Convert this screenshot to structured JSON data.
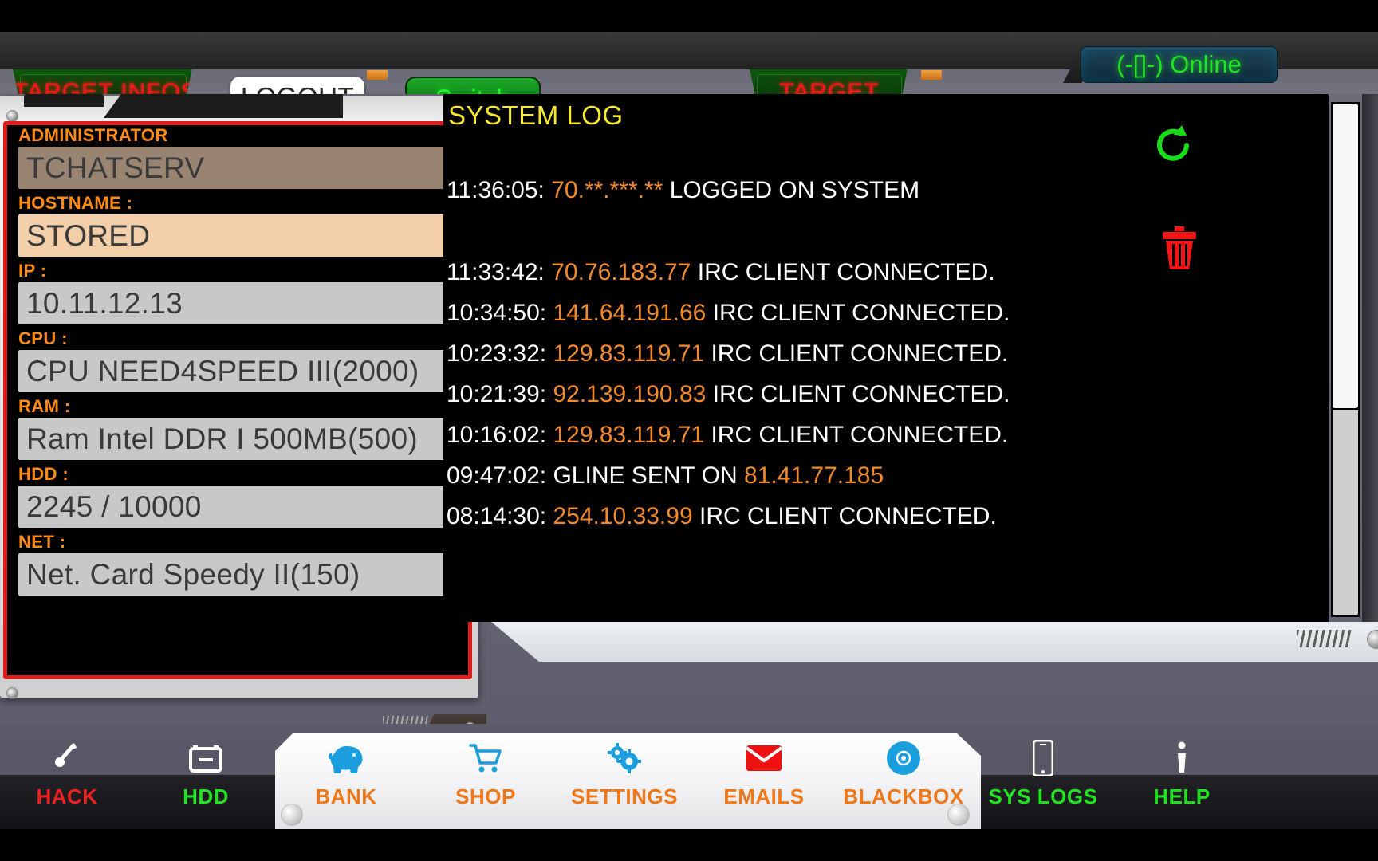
{
  "topbar": {
    "target_infos_tab": "TARGET INFOS",
    "logout_button": "LOGOUT",
    "switch_button": "Switch",
    "target_tab": "TARGET",
    "online_status": "(-[]-) Online"
  },
  "target_info": {
    "fields": [
      {
        "label": "ADMINISTRATOR",
        "value": "TCHATSERV",
        "style": "v-admin"
      },
      {
        "label": "HOSTNAME :",
        "value": "STORED",
        "style": "v-host"
      },
      {
        "label": "IP :",
        "value": "10.11.12.13",
        "style": "v-plain"
      },
      {
        "label": "CPU :",
        "value": "CPU NEED4SPEED III(2000)",
        "style": "v-plain"
      },
      {
        "label": "RAM :",
        "value": "Ram Intel DDR I 500MB(500)",
        "style": "v-plain"
      },
      {
        "label": "HDD :",
        "value": "2245 / 10000",
        "style": "v-plain"
      },
      {
        "label": "NET :",
        "value": "Net. Card Speedy II(150)",
        "style": "v-plain"
      }
    ]
  },
  "system_log": {
    "title": "SYSTEM LOG",
    "refresh_icon": "refresh-icon",
    "delete_icon": "trash-icon",
    "entries": [
      {
        "time": "11:36:05:",
        "ip": "70.**.***.**",
        "message": "LOGGED ON SYSTEM",
        "ip_first": true,
        "spaced": true
      },
      {
        "time": "11:33:42:",
        "ip": "70.76.183.77",
        "message": "IRC CLIENT CONNECTED.",
        "ip_first": true,
        "spaced": false
      },
      {
        "time": "10:34:50:",
        "ip": "141.64.191.66",
        "message": "IRC CLIENT CONNECTED.",
        "ip_first": true,
        "spaced": false
      },
      {
        "time": "10:23:32:",
        "ip": "129.83.119.71",
        "message": "IRC CLIENT CONNECTED.",
        "ip_first": true,
        "spaced": false
      },
      {
        "time": "10:21:39:",
        "ip": "92.139.190.83",
        "message": "IRC CLIENT CONNECTED.",
        "ip_first": true,
        "spaced": false
      },
      {
        "time": "10:16:02:",
        "ip": "129.83.119.71",
        "message": "IRC CLIENT CONNECTED.",
        "ip_first": true,
        "spaced": false
      },
      {
        "time": "09:47:02:",
        "ip": "81.41.77.185",
        "message": "GLINE SENT ON",
        "ip_first": false,
        "spaced": false
      },
      {
        "time": "08:14:30:",
        "ip": "254.10.33.99",
        "message": "IRC CLIENT CONNECTED.",
        "ip_first": true,
        "spaced": false
      }
    ]
  },
  "bottom_nav": [
    {
      "label": "HACK",
      "icon": "wrench-icon",
      "color": "lbl-red"
    },
    {
      "label": "HDD",
      "icon": "drive-icon",
      "color": "lbl-green"
    },
    {
      "label": "BANK",
      "icon": "piggybank-icon",
      "color": "lbl-orange"
    },
    {
      "label": "SHOP",
      "icon": "cart-icon",
      "color": "lbl-orange"
    },
    {
      "label": "SETTINGS",
      "icon": "gears-icon",
      "color": "lbl-orange"
    },
    {
      "label": "EMAILS",
      "icon": "envelope-icon",
      "color": "lbl-orange"
    },
    {
      "label": "BLACKBOX",
      "icon": "disc-icon",
      "color": "lbl-orange"
    },
    {
      "label": "SYS LOGS",
      "icon": "phone-icon",
      "color": "lbl-green"
    },
    {
      "label": "HELP",
      "icon": "info-icon",
      "color": "lbl-green"
    }
  ],
  "colors": {
    "accent_orange": "#f08a2a",
    "label_orange": "#ff8a14",
    "danger_red": "#e01b1b",
    "ok_green": "#22e322",
    "log_title_yellow": "#f6ea2a"
  }
}
